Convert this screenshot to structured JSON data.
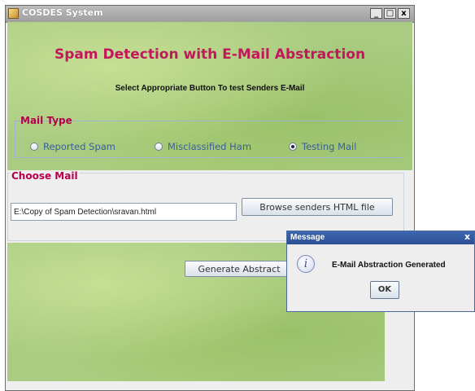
{
  "window": {
    "title": "COSDES System",
    "controls": [
      "minimize-icon",
      "maximize-icon",
      "close-icon"
    ],
    "control_glyphs": {
      "minimize": "_",
      "maximize": "□",
      "close": "x"
    }
  },
  "banner": {
    "heading": "Spam Detection with E-Mail Abstraction",
    "subheading": "Select Appropriate Button To test Senders E-Mail"
  },
  "mail_type": {
    "legend": "Mail Type",
    "options": [
      {
        "label": "Reported Spam",
        "selected": false
      },
      {
        "label": "Misclassified Ham",
        "selected": false
      },
      {
        "label": "Testing Mail",
        "selected": true
      }
    ]
  },
  "choose_mail": {
    "legend": "Choose Mail",
    "path_value": "E:\\Copy of Spam Detection\\sravan.html",
    "browse_label": "Browse senders HTML file"
  },
  "actions": {
    "generate_label": "Generate Abstract"
  },
  "dialog": {
    "title": "Message",
    "message": "E-Mail Abstraction Generated",
    "ok_label": "OK",
    "close_glyph": "x",
    "icon": "info-icon",
    "icon_glyph": "i"
  },
  "colors": {
    "heading": "#c2185b",
    "legend": "#b8004a",
    "radio_label": "#3b5f96",
    "banner_green": "#a9cc82",
    "dialog_title_bar": "#2d4f94"
  }
}
